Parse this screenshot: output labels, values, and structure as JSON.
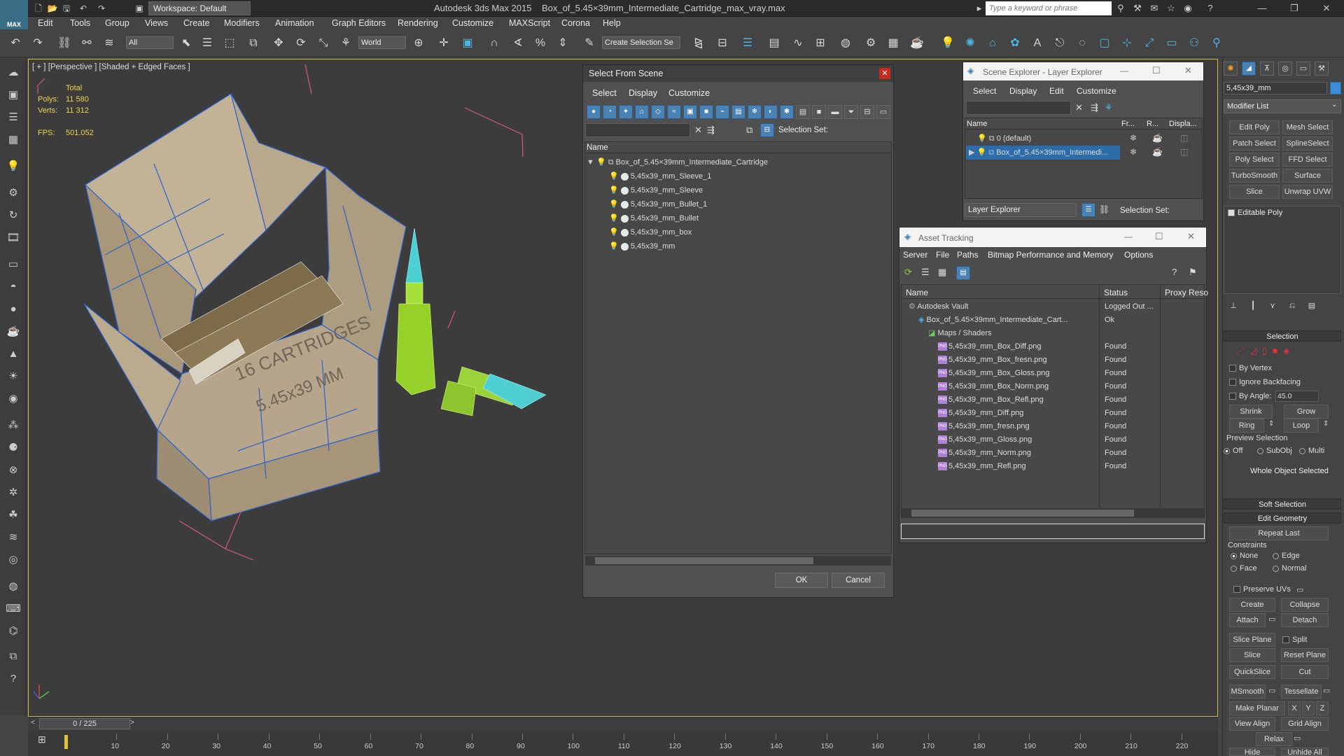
{
  "app": {
    "title": "Autodesk 3ds Max  2015",
    "file": "Box_of_5.45×39mm_Intermediate_Cartridge_max_vray.max",
    "workspace": "Workspace: Default",
    "search_placeholder": "Type a keyword or phrase",
    "logo": "MAX"
  },
  "menu": [
    "Edit",
    "Tools",
    "Group",
    "Views",
    "Create",
    "Modifiers",
    "Animation",
    "Graph Editors",
    "Rendering",
    "Customize",
    "MAXScript",
    "Corona",
    "Help"
  ],
  "toolbar": {
    "filter": "All",
    "coord": "World",
    "selection_set": "Create Selection Se"
  },
  "viewport": {
    "label": "[ + ] [Perspective ] [Shaded + Edged Faces ]",
    "total_label": "Total",
    "polys_label": "Polys:",
    "polys": "11 580",
    "verts_label": "Verts:",
    "verts": "11 312",
    "fps_label": "FPS:",
    "fps": "501.052",
    "box_text1": "16 CARTRIDGES",
    "box_text2": "5.45x39 MM"
  },
  "select_from_scene": {
    "title": "Select From Scene",
    "menu": [
      "Select",
      "Display",
      "Customize"
    ],
    "selection_set_label": "Selection Set:",
    "col_name": "Name",
    "root": "Box_of_5.45×39mm_Intermediate_Cartridge",
    "items": [
      "5,45x39_mm_Sleeve_1",
      "5,45x39_mm_Sleeve",
      "5,45x39_mm_Bullet_1",
      "5,45x39_mm_Bullet",
      "5,45x39_mm_box",
      "5,45x39_mm"
    ],
    "ok": "OK",
    "cancel": "Cancel"
  },
  "scene_explorer": {
    "title": "Scene Explorer - Layer Explorer",
    "menu": [
      "Select",
      "Display",
      "Edit",
      "Customize"
    ],
    "cols": [
      "Name",
      "Fr...",
      "R...",
      "Displa..."
    ],
    "rows": [
      "0 (default)",
      "Box_of_5.45×39mm_Intermedi..."
    ],
    "footer_dropdown": "Layer Explorer",
    "selection_set_label": "Selection Set:"
  },
  "asset_tracking": {
    "title": "Asset Tracking",
    "menu": [
      "Server",
      "File",
      "Paths",
      "Bitmap Performance and Memory",
      "Options"
    ],
    "cols": [
      "Name",
      "Status",
      "Proxy Reso"
    ],
    "rows": [
      {
        "name": "Autodesk Vault",
        "status": "Logged Out ...",
        "indent": 0,
        "icon": "vault"
      },
      {
        "name": "Box_of_5.45×39mm_Intermediate_Cart...",
        "status": "Ok",
        "indent": 1,
        "icon": "max"
      },
      {
        "name": "Maps / Shaders",
        "status": "",
        "indent": 2,
        "icon": "maps"
      },
      {
        "name": "5,45x39_mm_Box_Diff.png",
        "status": "Found",
        "indent": 3,
        "icon": "png"
      },
      {
        "name": "5,45x39_mm_Box_fresn.png",
        "status": "Found",
        "indent": 3,
        "icon": "png"
      },
      {
        "name": "5,45x39_mm_Box_Gloss.png",
        "status": "Found",
        "indent": 3,
        "icon": "png"
      },
      {
        "name": "5,45x39_mm_Box_Norm.png",
        "status": "Found",
        "indent": 3,
        "icon": "png"
      },
      {
        "name": "5,45x39_mm_Box_Refl.png",
        "status": "Found",
        "indent": 3,
        "icon": "png"
      },
      {
        "name": "5,45x39_mm_Diff.png",
        "status": "Found",
        "indent": 3,
        "icon": "png"
      },
      {
        "name": "5,45x39_mm_fresn.png",
        "status": "Found",
        "indent": 3,
        "icon": "png"
      },
      {
        "name": "5,45x39_mm_Gloss.png",
        "status": "Found",
        "indent": 3,
        "icon": "png"
      },
      {
        "name": "5,45x39_mm_Norm.png",
        "status": "Found",
        "indent": 3,
        "icon": "png"
      },
      {
        "name": "5,45x39_mm_Refl.png",
        "status": "Found",
        "indent": 3,
        "icon": "png"
      }
    ]
  },
  "command_panel": {
    "object_name": "5,45x39_mm",
    "modifier_list": "Modifier List",
    "mod_buttons": [
      "Edit Poly",
      "Mesh Select",
      "Patch Select",
      "SplineSelect",
      "Poly Select",
      "FFD Select",
      "TurboSmooth",
      "Surface Select",
      "Slice",
      "Unwrap UVW"
    ],
    "stack_item": "Editable Poly",
    "selection_header": "Selection",
    "by_vertex": "By Vertex",
    "ignore_backfacing": "Ignore Backfacing",
    "by_angle": "By Angle:",
    "angle_value": "45.0",
    "shrink": "Shrink",
    "grow": "Grow",
    "ring": "Ring",
    "loop": "Loop",
    "preview_selection": "Preview Selection",
    "preview_opts": [
      "Off",
      "SubObj",
      "Multi"
    ],
    "whole_object": "Whole Object Selected",
    "soft_selection": "Soft Selection",
    "edit_geometry": "Edit Geometry",
    "repeat_last": "Repeat Last",
    "constraints": "Constraints",
    "constraint_opts": [
      "None",
      "Edge",
      "Face",
      "Normal"
    ],
    "preserve_uvs": "Preserve UVs",
    "create": "Create",
    "collapse": "Collapse",
    "attach": "Attach",
    "detach": "Detach",
    "slice_plane": "Slice Plane",
    "split": "Split",
    "slice": "Slice",
    "reset_plane": "Reset Plane",
    "quickslice": "QuickSlice",
    "cut": "Cut",
    "msmooth": "MSmooth",
    "tessellate": "Tessellate",
    "make_planar": "Make Planar",
    "x": "X",
    "y": "Y",
    "z": "Z",
    "view_align": "View Align",
    "grid_align": "Grid Align",
    "relax": "Relax",
    "hide_selected": "Hide Selected",
    "unhide_all": "Unhide All"
  },
  "timeline": {
    "frame": "0 / 225",
    "ticks": [
      "10",
      "20",
      "30",
      "40",
      "50",
      "60",
      "70",
      "80",
      "90",
      "100",
      "110",
      "120",
      "130",
      "140",
      "150",
      "160",
      "170",
      "180",
      "190",
      "200",
      "210",
      "220"
    ]
  }
}
